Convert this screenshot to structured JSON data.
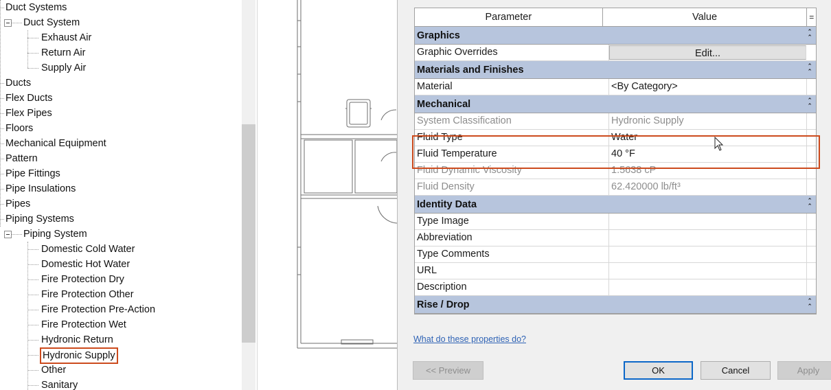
{
  "tree": {
    "items": [
      {
        "label": "Duct Systems",
        "level": 0
      },
      {
        "label": "Duct System",
        "level": 1
      },
      {
        "label": "Exhaust Air",
        "level": 2
      },
      {
        "label": "Return Air",
        "level": 2
      },
      {
        "label": "Supply Air",
        "level": 2
      },
      {
        "label": "Ducts",
        "level": 0
      },
      {
        "label": "Flex Ducts",
        "level": 0
      },
      {
        "label": "Flex Pipes",
        "level": 0
      },
      {
        "label": "Floors",
        "level": 0
      },
      {
        "label": "Mechanical Equipment",
        "level": 0
      },
      {
        "label": "Pattern",
        "level": 0
      },
      {
        "label": "Pipe Fittings",
        "level": 0
      },
      {
        "label": "Pipe Insulations",
        "level": 0
      },
      {
        "label": "Pipes",
        "level": 0
      },
      {
        "label": "Piping Systems",
        "level": 0
      },
      {
        "label": "Piping System",
        "level": 1
      },
      {
        "label": "Domestic Cold Water",
        "level": 2
      },
      {
        "label": "Domestic Hot Water",
        "level": 2
      },
      {
        "label": "Fire Protection Dry",
        "level": 2
      },
      {
        "label": "Fire Protection Other",
        "level": 2
      },
      {
        "label": "Fire Protection Pre-Action",
        "level": 2
      },
      {
        "label": "Fire Protection Wet",
        "level": 2
      },
      {
        "label": "Hydronic Return",
        "level": 2
      },
      {
        "label": "Hydronic Supply",
        "level": 2,
        "selected": true
      },
      {
        "label": "Other",
        "level": 2
      },
      {
        "label": "Sanitary",
        "level": 2
      }
    ]
  },
  "properties": {
    "header": {
      "parameter": "Parameter",
      "value": "Value",
      "eq": "="
    },
    "groups": [
      {
        "name": "Graphics",
        "rows": [
          {
            "param": "Graphic Overrides",
            "value": "Edit...",
            "button": true
          }
        ]
      },
      {
        "name": "Materials and Finishes",
        "rows": [
          {
            "param": "Material",
            "value": "<By Category>"
          }
        ]
      },
      {
        "name": "Mechanical",
        "rows": [
          {
            "param": "System Classification",
            "value": "Hydronic Supply",
            "dim": true
          },
          {
            "param": "Fluid Type",
            "value": "Water",
            "highlighted": true
          },
          {
            "param": "Fluid Temperature",
            "value": "40 °F",
            "highlighted": true
          },
          {
            "param": "Fluid Dynamic Viscosity",
            "value": "1.5638 cP",
            "dim": true
          },
          {
            "param": "Fluid Density",
            "value": "62.420000 lb/ft³",
            "dim": true
          }
        ]
      },
      {
        "name": "Identity Data",
        "rows": [
          {
            "param": "Type Image",
            "value": ""
          },
          {
            "param": "Abbreviation",
            "value": ""
          },
          {
            "param": "Type Comments",
            "value": ""
          },
          {
            "param": "URL",
            "value": ""
          },
          {
            "param": "Description",
            "value": ""
          }
        ]
      },
      {
        "name": "Rise / Drop",
        "rows": []
      }
    ],
    "collapse_glyph": "⌃⌃"
  },
  "help_link": "What do these properties do?",
  "buttons": {
    "preview": "<< Preview",
    "ok": "OK",
    "cancel": "Cancel",
    "apply": "Apply"
  },
  "colors": {
    "highlight": "#cc4a1c",
    "group_header": "#b7c5dd",
    "link": "#2f63b5"
  }
}
